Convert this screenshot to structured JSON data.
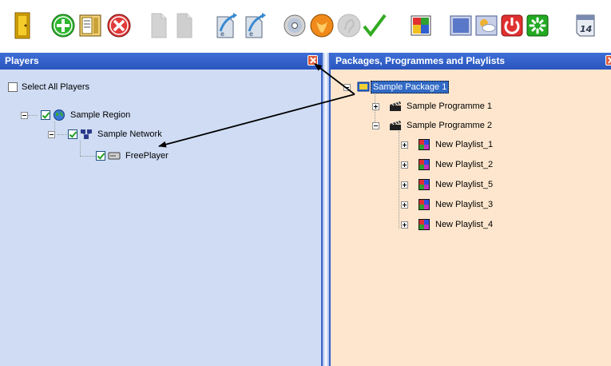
{
  "toolbar": {
    "buttons": [
      {
        "name": "exit-door-icon",
        "color": "#e9b800"
      },
      {
        "name": "add-icon",
        "color": "#2fb52f"
      },
      {
        "name": "properties-icon",
        "color": "#caa23a"
      },
      {
        "name": "delete-icon",
        "color": "#e03a3a"
      },
      {
        "name": "copy-disabled-icon",
        "color": "#9a9a9a"
      },
      {
        "name": "paste-disabled-icon",
        "color": "#9a9a9a"
      },
      {
        "name": "import-icon",
        "color": "#6a8ab0"
      },
      {
        "name": "export-icon",
        "color": "#6a8ab0"
      },
      {
        "name": "disc-icon",
        "color": "#b0b0b0"
      },
      {
        "name": "orange-circle-icon",
        "color": "#f08a1a"
      },
      {
        "name": "grey-circle-icon",
        "color": "#a0a0a0"
      },
      {
        "name": "checkmark-icon",
        "color": "#33aa22"
      },
      {
        "name": "color-blocks-icon",
        "color": "#e03030"
      },
      {
        "name": "display-icon",
        "color": "#4a6ab8"
      },
      {
        "name": "weather-icon",
        "color": "#f0b030"
      },
      {
        "name": "power-icon",
        "color": "#e03030"
      },
      {
        "name": "green-spinner-icon",
        "color": "#22aa22"
      },
      {
        "name": "calendar-icon",
        "color": "#7a8ab0"
      }
    ],
    "calendar_number": "14"
  },
  "players_panel": {
    "title": "Players",
    "select_all_label": "Select All Players",
    "tree": {
      "region": "Sample Region",
      "network": "Sample Network",
      "player": "FreePlayer"
    }
  },
  "packages_panel": {
    "title": "Packages, Programmes and Playlists",
    "tree": {
      "package": "Sample Package 1",
      "programmes": [
        "Sample Programme 1",
        "Sample Programme 2"
      ],
      "playlists": [
        "New Playlist_1",
        "New Playlist_2",
        "New Playlist_5",
        "New Playlist_3",
        "New Playlist_4"
      ]
    }
  },
  "colors": {
    "players_bg": "#cfdcf4",
    "packages_bg": "#fde6cd",
    "header_blue": "#2a55be",
    "selection": "#316ac5"
  }
}
